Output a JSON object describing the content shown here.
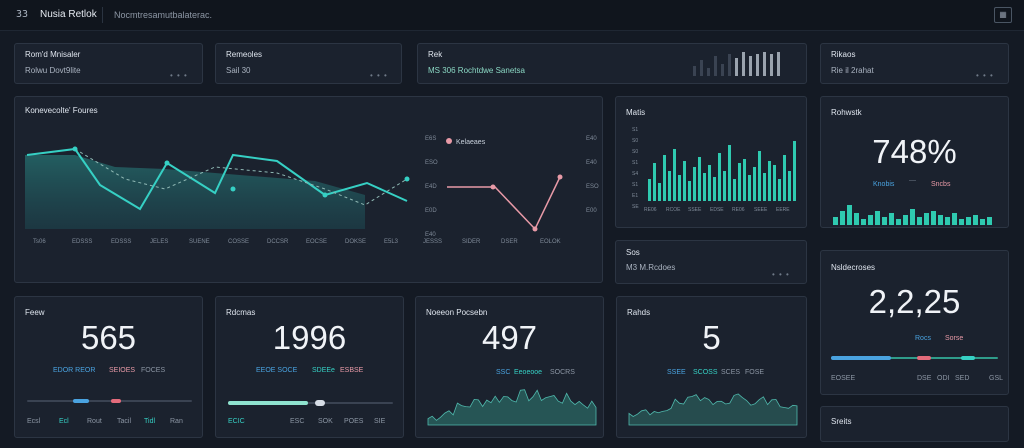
{
  "topbar": {
    "logo": "33",
    "app": "Nusia Retlok",
    "crumb": "Nocmtresamutbalaterac.",
    "menu_icon": "grid-icon"
  },
  "stat_cards": [
    {
      "title": "Rom'd Mnisaler",
      "sub": "Rolwu Dovt9lite",
      "dots": "• • •"
    },
    {
      "title": "Remeoles",
      "sub": "Sail 30",
      "dots": "• • •"
    },
    {
      "title": "Rek",
      "sub": "MS 306 Rochtdwe Sanetsa",
      "dots": ""
    },
    {
      "title": "Rikaos",
      "sub": "Rie il 2rahat",
      "dots": "• • •"
    }
  ],
  "line_chart": {
    "title": "Konevecolte' Foures",
    "legend": "Kelaeaes",
    "x_ticks": [
      "Ts06",
      "EDSSS",
      "EDSSS",
      "JELES",
      "SUENE",
      "COSSE",
      "DCCSR",
      "EOCSE",
      "DOKSE",
      "E5L3",
      "JESSS",
      "SIDER",
      "DSER",
      "EOLOK"
    ],
    "y_ticks": [
      "E6S",
      "ESO",
      "E4D",
      "E0D",
      "E40",
      "E40",
      "E40",
      "ESO",
      "E00"
    ],
    "accent": "#36d0c4",
    "secondary": "#e89aa7"
  },
  "mini_chart": {
    "title": "Matis",
    "y_ticks": [
      "S1",
      "S0",
      "S0",
      "S1",
      "S4",
      "S1",
      "E1",
      "SE"
    ],
    "x_ticks": [
      "RE06",
      "RCOE",
      "SSEE",
      "EDSE",
      "RE06",
      "SEEE",
      "EERE"
    ]
  },
  "sos_card": {
    "title": "Sos",
    "sub": "M3 M.Rcdoes",
    "dots": "• • •"
  },
  "pct_card": {
    "title": "Rohwstk",
    "value": "748%",
    "legend": [
      "Knobis",
      "Sncbs"
    ]
  },
  "kpis": [
    {
      "title": "Feew",
      "value": "565",
      "legend": [
        "EDOR REOR",
        "SEIOES",
        "FOCES"
      ],
      "foot": [
        "Ecsl",
        "Ecl",
        "Rout",
        "Tacil",
        "Tidl",
        "Ran"
      ]
    },
    {
      "title": "Rdcmas",
      "value": "1996",
      "legend": [
        "EEOE SOCE",
        "SDEEe",
        "ESBSE"
      ],
      "foot": [
        "ECIC",
        "ESC",
        "SOK",
        "POES",
        "SIE"
      ]
    },
    {
      "title": "Noeeon Pocsebn",
      "value": "497",
      "legend": [
        "SSC",
        "Eeoeooe",
        "SOCRS"
      ],
      "foot": []
    },
    {
      "title": "Rahds",
      "value": "5",
      "legend": [
        "SSEE",
        "SCOSS",
        "SCES",
        "FOSE"
      ],
      "foot": []
    }
  ],
  "right_kpi": {
    "title": "Nsldecroses",
    "value": "2,2,25",
    "legend": [
      "Rocs",
      "Sorse"
    ],
    "foot": [
      "EOSEE",
      "DSE",
      "ODI",
      "SED",
      "GSL"
    ]
  },
  "bottom_right": {
    "title": "Sreits"
  }
}
